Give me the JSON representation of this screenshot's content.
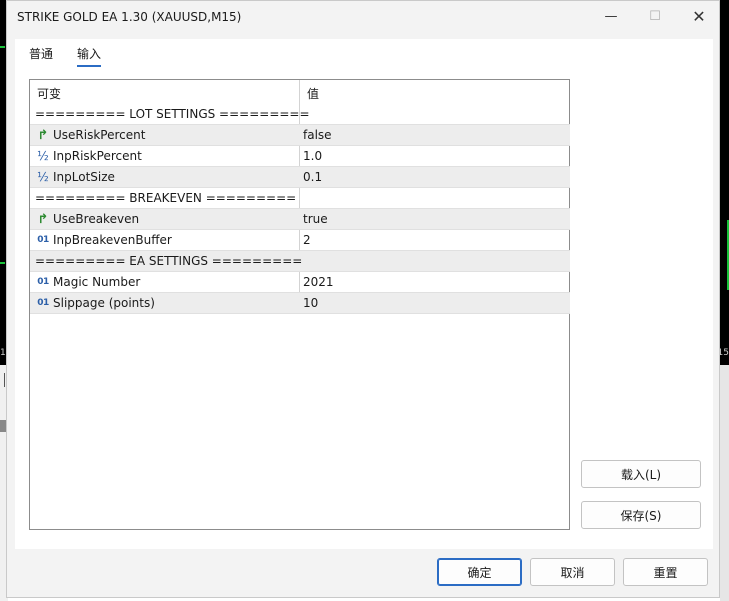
{
  "window": {
    "title": "STRIKE GOLD EA 1.30 (XAUUSD,M15)"
  },
  "title_buttons": {
    "minimize": "—",
    "maximize": "☐",
    "close": "✕"
  },
  "background": {
    "axis_left": "1",
    "axis_right": "15"
  },
  "tabs": [
    {
      "label": "普通",
      "active": false
    },
    {
      "label": "输入",
      "active": true
    }
  ],
  "grid": {
    "col_variable": "可变",
    "col_value": "值",
    "rows": [
      {
        "type": "separator",
        "name": "========= LOT SETTINGS =========",
        "value": ""
      },
      {
        "type": "bool",
        "name": "UseRiskPercent",
        "value": "false"
      },
      {
        "type": "double",
        "name": "InpRiskPercent",
        "value": "1.0"
      },
      {
        "type": "double",
        "name": "InpLotSize",
        "value": "0.1"
      },
      {
        "type": "separator",
        "name": "========= BREAKEVEN =========",
        "value": ""
      },
      {
        "type": "bool",
        "name": "UseBreakeven",
        "value": "true"
      },
      {
        "type": "int",
        "name": "InpBreakevenBuffer",
        "value": "2"
      },
      {
        "type": "separator",
        "name": "========= EA SETTINGS =========",
        "value": ""
      },
      {
        "type": "int",
        "name": "Magic Number",
        "value": "2021"
      },
      {
        "type": "int",
        "name": "Slippage (points)",
        "value": "10"
      }
    ]
  },
  "icons": {
    "bool": "↱",
    "double": "½",
    "int": "01"
  },
  "side_buttons": {
    "load": "载入(L)",
    "save": "保存(S)"
  },
  "footer": {
    "ok": "确定",
    "cancel": "取消",
    "reset": "重置"
  },
  "colors": {
    "accent": "#2b6cc4",
    "bool_icon": "#2e8b32",
    "numeric_icon": "#2c5fa8",
    "row_alt": "#ededed"
  }
}
